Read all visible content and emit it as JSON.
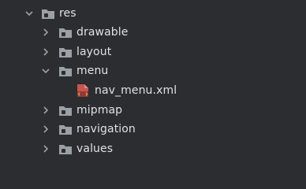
{
  "tree": {
    "root": {
      "label": "res",
      "expanded": true,
      "icon": "folder-icon"
    },
    "children": [
      {
        "label": "drawable",
        "expanded": false,
        "icon": "folder-icon"
      },
      {
        "label": "layout",
        "expanded": false,
        "icon": "folder-icon"
      },
      {
        "label": "menu",
        "expanded": true,
        "icon": "folder-icon",
        "children": [
          {
            "label": "nav_menu.xml",
            "icon": "xml-file-icon"
          }
        ]
      },
      {
        "label": "mipmap",
        "expanded": false,
        "icon": "folder-icon"
      },
      {
        "label": "navigation",
        "expanded": false,
        "icon": "folder-icon"
      },
      {
        "label": "values",
        "expanded": false,
        "icon": "folder-icon"
      }
    ]
  },
  "colors": {
    "background": "#2b2d30",
    "text": "#dfe1e5",
    "chevron": "#9da0a8",
    "folder": "#9aa0a6",
    "folder_badge": "#2b2d30",
    "xml_file": "#c75450",
    "xml_accent": "#e8a33d"
  }
}
